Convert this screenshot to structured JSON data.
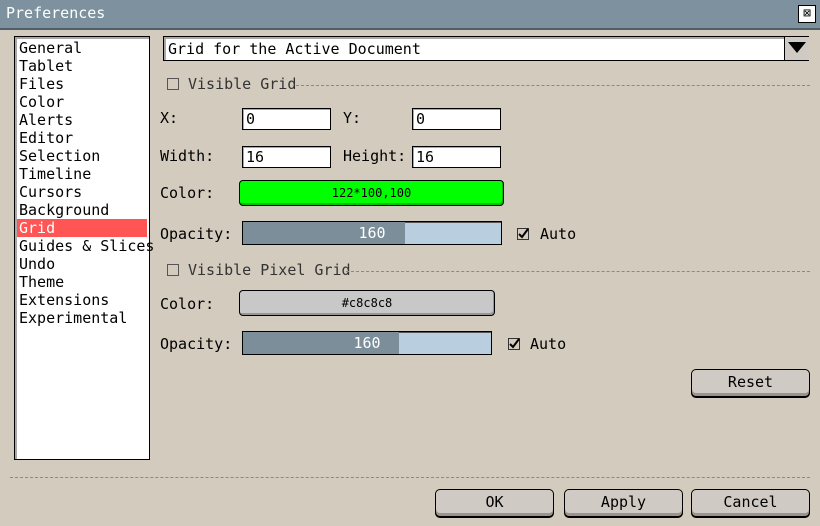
{
  "window": {
    "title": "Preferences",
    "close_glyph": "⊠"
  },
  "sidebar": {
    "items": [
      {
        "label": "General"
      },
      {
        "label": "Tablet"
      },
      {
        "label": "Files"
      },
      {
        "label": "Color"
      },
      {
        "label": "Alerts"
      },
      {
        "label": "Editor"
      },
      {
        "label": "Selection"
      },
      {
        "label": "Timeline"
      },
      {
        "label": "Cursors"
      },
      {
        "label": "Background"
      },
      {
        "label": "Grid"
      },
      {
        "label": "Guides & Slices"
      },
      {
        "label": "Undo"
      },
      {
        "label": "Theme"
      },
      {
        "label": "Extensions"
      },
      {
        "label": "Experimental"
      }
    ],
    "selected": "Grid"
  },
  "scope_select": {
    "value": "Grid for the Active Document",
    "arrow_icon": "triangle-down-icon"
  },
  "grid": {
    "visible_label": "Visible Grid",
    "visible_checked": false,
    "x_label": "X:",
    "x_value": "0",
    "y_label": "Y:",
    "y_value": "0",
    "width_label": "Width:",
    "width_value": "16",
    "height_label": "Height:",
    "height_value": "16",
    "color_label": "Color:",
    "color_text": "122*100,100",
    "color_swatch": "#00ff00",
    "opacity_label": "Opacity:",
    "opacity_value": "160",
    "opacity_max": 255,
    "auto_label": "Auto",
    "auto_checked": true
  },
  "pixel_grid": {
    "visible_label": "Visible Pixel Grid",
    "visible_checked": false,
    "color_label": "Color:",
    "color_text": "#c8c8c8",
    "color_swatch": "#c8c8c8",
    "opacity_label": "Opacity:",
    "opacity_value": "160",
    "opacity_max": 255,
    "auto_label": "Auto",
    "auto_checked": true
  },
  "buttons": {
    "reset": "Reset",
    "ok": "OK",
    "apply": "Apply",
    "cancel": "Cancel"
  },
  "colors": {
    "titlebar": "#7d929e",
    "selection": "#ff5555",
    "slider_fill": "#7c8e99",
    "slider_track": "#b9cfe0"
  }
}
